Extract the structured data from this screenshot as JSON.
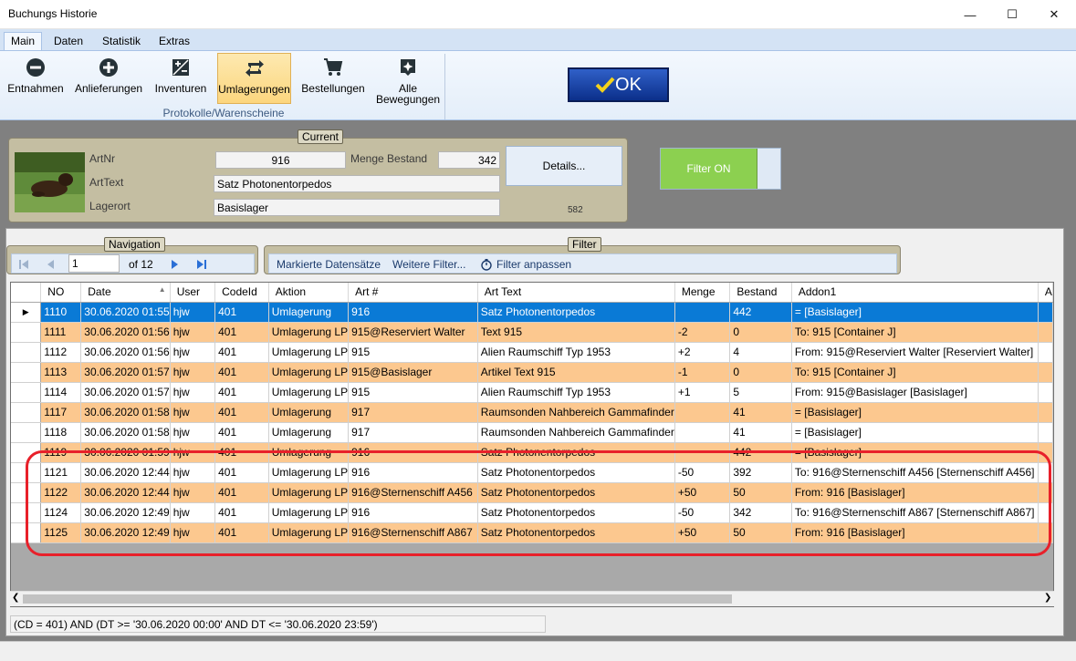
{
  "window": {
    "title": "Buchungs Historie",
    "minimize_glyph": "—",
    "maximize_glyph": "☐",
    "close_glyph": "✕"
  },
  "ribbon": {
    "tabs": [
      "Main",
      "Daten",
      "Statistik",
      "Extras"
    ],
    "active_tab": "Main",
    "buttons": {
      "entnahmen": "Entnahmen",
      "anlieferungen": "Anlieferungen",
      "inventuren": "Inventuren",
      "umlagerungen": "Umlagerungen",
      "bestellungen": "Bestellungen",
      "alle_1": "Alle",
      "alle_2": "Bewegungen"
    },
    "group_label": "Protokolle/Warenscheine",
    "ok_label": "OK"
  },
  "current": {
    "title": "Current",
    "artnr_label": "ArtNr",
    "artnr_value": "916",
    "menge_label": "Menge Bestand",
    "menge_value": "342",
    "arttext_label": "ArtText",
    "arttext_value": "Satz Photonentorpedos",
    "lagerort_label": "Lagerort",
    "lagerort_value": "Basislager",
    "details_label": "Details...",
    "details_count": "582"
  },
  "filter_on_label": "Filter ON",
  "navigation": {
    "title": "Navigation",
    "page_value": "1",
    "of_label": "of 12"
  },
  "filter": {
    "title": "Filter",
    "markierte": "Markierte Datensätze",
    "weitere": "Weitere Filter...",
    "anpassen": "Filter anpassen"
  },
  "grid": {
    "columns": [
      "NO",
      "Date",
      "User",
      "CodeId",
      "Aktion",
      "Art #",
      "Art Text",
      "Menge",
      "Bestand",
      "Addon1",
      "A"
    ],
    "sort_indicator": "▲",
    "rows": [
      {
        "style": "sel",
        "cells": [
          "1110",
          "30.06.2020 01:55",
          "hjw",
          "401",
          "Umlagerung",
          "916",
          "Satz Photonentorpedos",
          "",
          "442",
          "= [Basislager]"
        ]
      },
      {
        "style": "o",
        "cells": [
          "1111",
          "30.06.2020 01:56",
          "hjw",
          "401",
          "Umlagerung LP",
          "915@Reserviert Walter",
          "Text 915",
          "-2",
          "0",
          "To: 915 [Container J]"
        ]
      },
      {
        "style": "w",
        "cells": [
          "1112",
          "30.06.2020 01:56",
          "hjw",
          "401",
          "Umlagerung LP",
          "915",
          "Alien Raumschiff Typ 1953",
          "+2",
          "4",
          "From: 915@Reserviert Walter [Reserviert Walter]"
        ]
      },
      {
        "style": "o",
        "cells": [
          "1113",
          "30.06.2020 01:57",
          "hjw",
          "401",
          "Umlagerung LP",
          "915@Basislager",
          "Artikel Text 915",
          "-1",
          "0",
          "To: 915 [Container J]"
        ]
      },
      {
        "style": "w",
        "cells": [
          "1114",
          "30.06.2020 01:57",
          "hjw",
          "401",
          "Umlagerung LP",
          "915",
          "Alien Raumschiff Typ 1953",
          "+1",
          "5",
          "From: 915@Basislager [Basislager]"
        ]
      },
      {
        "style": "o",
        "cells": [
          "1117",
          "30.06.2020 01:58",
          "hjw",
          "401",
          "Umlagerung",
          "917",
          "Raumsonden Nahbereich Gammafinder",
          "",
          "41",
          "= [Basislager]"
        ]
      },
      {
        "style": "w",
        "cells": [
          "1118",
          "30.06.2020 01:58",
          "hjw",
          "401",
          "Umlagerung",
          "917",
          "Raumsonden Nahbereich Gammafinder",
          "",
          "41",
          "= [Basislager]"
        ]
      },
      {
        "style": "o",
        "cells": [
          "1119",
          "30.06.2020 01:59",
          "hjw",
          "401",
          "Umlagerung",
          "916",
          "Satz Photonentorpedos",
          "",
          "442",
          "= [Basislager]"
        ]
      },
      {
        "style": "w",
        "cells": [
          "1121",
          "30.06.2020 12:44",
          "hjw",
          "401",
          "Umlagerung LP",
          "916",
          "Satz Photonentorpedos",
          "-50",
          "392",
          "To: 916@Sternenschiff A456 [Sternenschiff A456]"
        ]
      },
      {
        "style": "o",
        "cells": [
          "1122",
          "30.06.2020 12:44",
          "hjw",
          "401",
          "Umlagerung LP",
          "916@Sternenschiff A456",
          "Satz Photonentorpedos",
          "+50",
          "50",
          "From: 916 [Basislager]"
        ]
      },
      {
        "style": "w",
        "cells": [
          "1124",
          "30.06.2020 12:49",
          "hjw",
          "401",
          "Umlagerung LP",
          "916",
          "Satz Photonentorpedos",
          "-50",
          "342",
          "To: 916@Sternenschiff A867 [Sternenschiff A867]"
        ]
      },
      {
        "style": "o",
        "cells": [
          "1125",
          "30.06.2020 12:49",
          "hjw",
          "401",
          "Umlagerung LP",
          "916@Sternenschiff A867",
          "Satz Photonentorpedos",
          "+50",
          "50",
          "From: 916 [Basislager]"
        ]
      }
    ]
  },
  "filter_expression": "(CD = 401) AND (DT >= '30.06.2020 00:00' AND DT <= '30.06.2020 23:59')",
  "colors": {
    "row_orange": "#fcc88f",
    "row_selected": "#0a7ad6",
    "highlight": "#e8202a",
    "filter_on": "#8cd050"
  }
}
